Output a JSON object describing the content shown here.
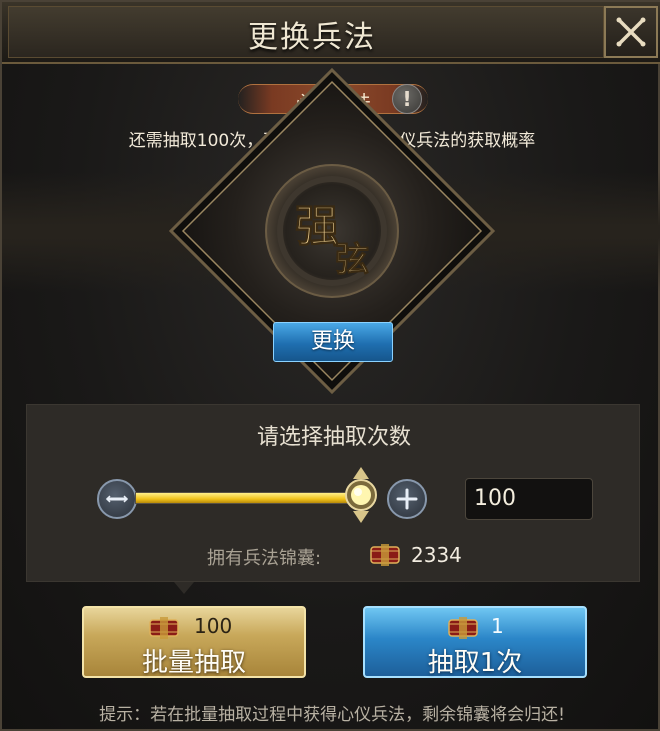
{
  "header": {
    "title": "更换兵法"
  },
  "badge": {
    "label": "心仪兵法"
  },
  "notice": "还需抽取100次，可激活印记提升心仪兵法的获取概率",
  "emblem": {
    "line1": "强",
    "line2": "弦"
  },
  "swap_button": "更换",
  "selector": {
    "title": "请选择抽取次数",
    "count_value": "100",
    "slider_fill_fraction": 1.0,
    "owned_label": "拥有兵法锦囊:",
    "owned_value": "2334"
  },
  "actions": {
    "batch": {
      "cost": "100",
      "label": "批量抽取"
    },
    "single": {
      "cost": "1",
      "label": "抽取1次"
    }
  },
  "tip": "提示：若在批量抽取过程中获得心仪兵法，剩余锦囊将会归还!",
  "icons": {
    "close": "close-icon",
    "info": "info-icon",
    "pouch": "scroll-pouch-icon",
    "minus": "minus-icon",
    "plus": "plus-icon"
  },
  "colors": {
    "gold_accent": "#f1c21a",
    "blue_button": "#2b86c8",
    "gold_button": "#c8a85a"
  }
}
